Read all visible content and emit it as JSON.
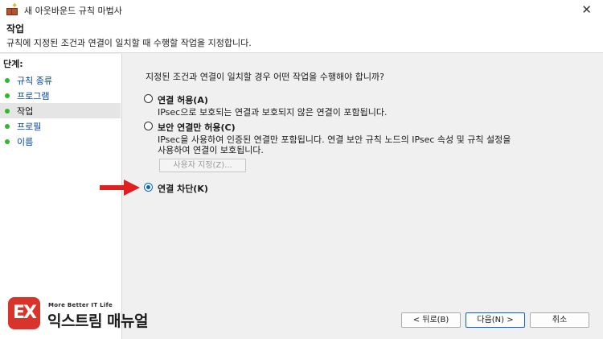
{
  "window": {
    "title": "새 아웃바운드 규칙 마법사",
    "close_glyph": "✕"
  },
  "header": {
    "title": "작업",
    "description": "규칙에 지정된 조건과 연결이 일치할 때 수행할 작업을 지정합니다."
  },
  "sidebar": {
    "steps_label": "단계:",
    "items": [
      {
        "label": "규칙 종류",
        "state": "done"
      },
      {
        "label": "프로그램",
        "state": "done"
      },
      {
        "label": "작업",
        "state": "current"
      },
      {
        "label": "프로필",
        "state": "pending"
      },
      {
        "label": "이름",
        "state": "pending"
      }
    ]
  },
  "main": {
    "question": "지정된 조건과 연결이 일치할 경우 어떤 작업을 수행해야 합니까?",
    "options": [
      {
        "label": "연결 허용(A)",
        "desc_lines": [
          "IPsec으로 보호되는 연결과 보호되지 않은 연결이 포함됩니다."
        ],
        "checked": false
      },
      {
        "label": "보안 연결만 허용(C)",
        "desc_lines": [
          "IPsec을 사용하여 인증된 연결만 포함됩니다. 연결 보안 규칙 노드의 IPsec 속성 및 규칙 설정을",
          "사용하여 연결이 보호됩니다."
        ],
        "checked": false
      },
      {
        "label": "연결 차단(K)",
        "desc_lines": [],
        "checked": true
      }
    ],
    "customize_button": "사용자 지정(Z)..."
  },
  "footer": {
    "back_button": "< 뒤로(B)",
    "next_button": "다음(N) >",
    "cancel_button": "취소"
  },
  "watermark": {
    "logo_text": "EX",
    "tagline": "More Better IT Life",
    "name": "익스트림 매뉴얼"
  },
  "colors": {
    "accent": "#0a64c8",
    "step_dot": "#2eb82e",
    "arrow": "#e02020",
    "brand_red": "#d9342b"
  },
  "icons": {
    "app": "firewall-icon",
    "close": "close-icon",
    "pointer": "red-arrow-icon"
  }
}
